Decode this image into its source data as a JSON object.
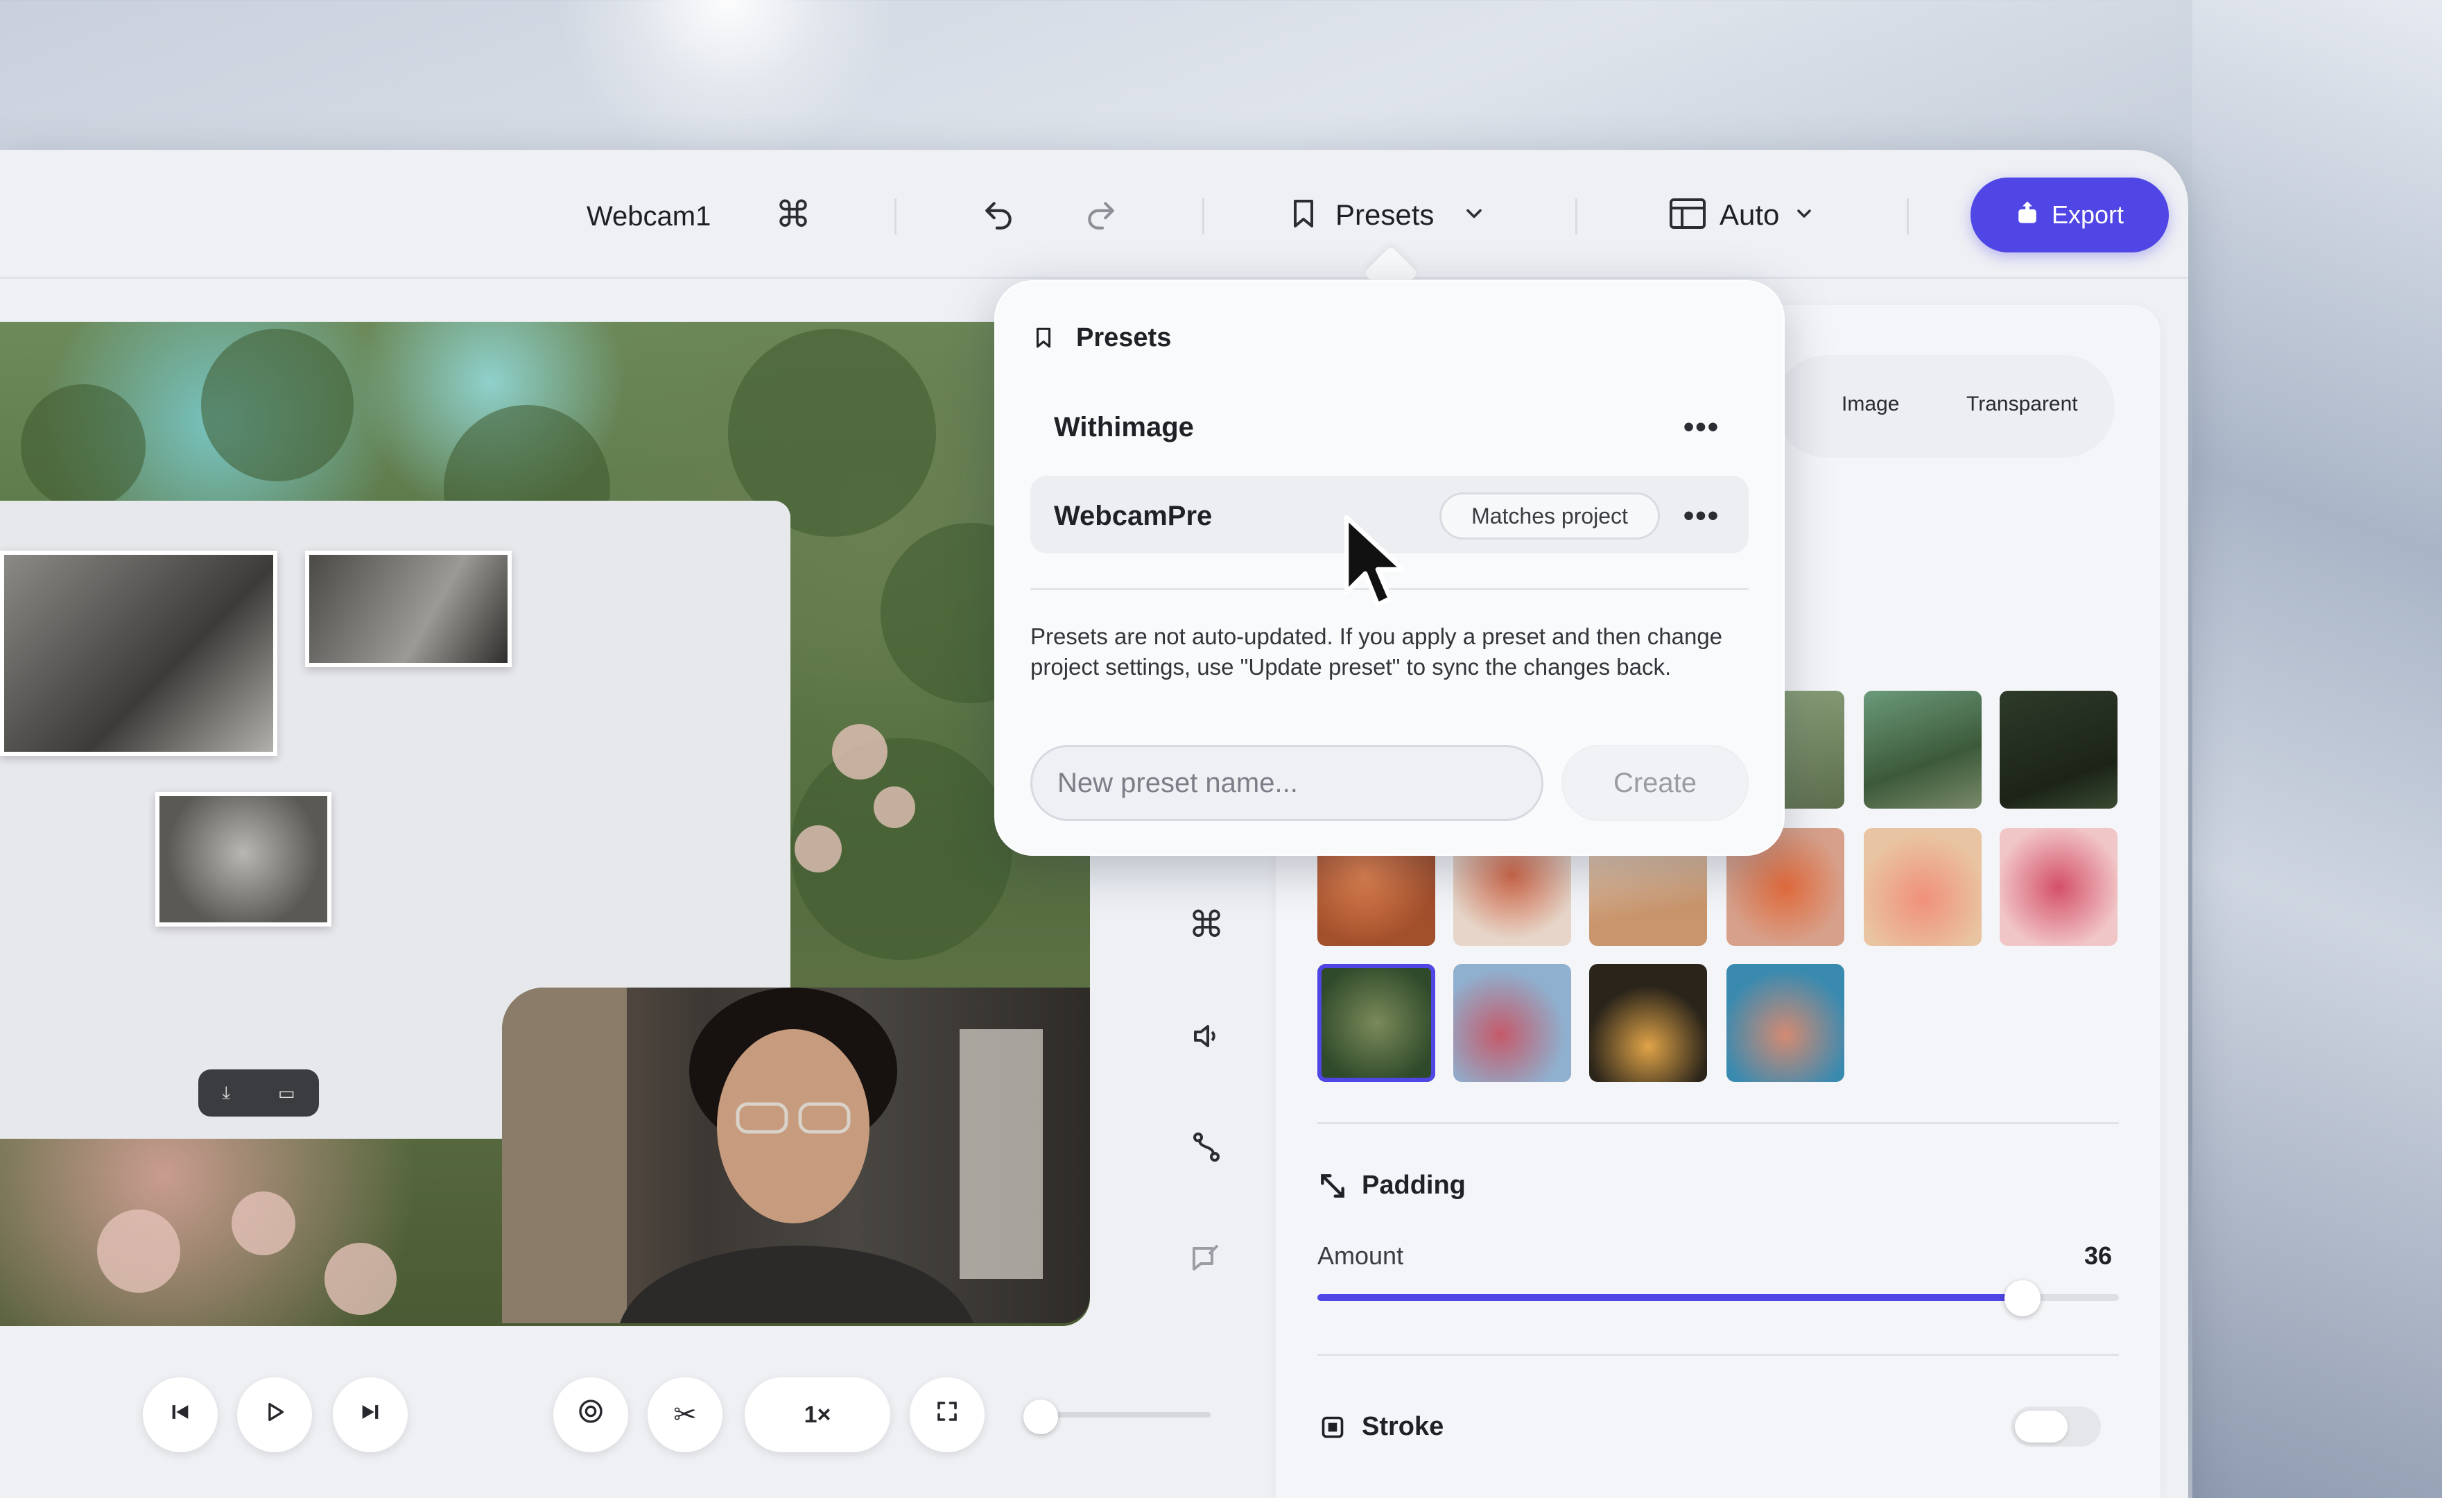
{
  "toolbar": {
    "project_name": "Webcam1",
    "presets_label": "Presets",
    "layout_label": "Auto",
    "export_label": "Export"
  },
  "background_tabs": {
    "image_label": "Image",
    "transparent_label": "Transparent"
  },
  "presets_popover": {
    "title": "Presets",
    "items": [
      {
        "name": "Withimage",
        "badge": ""
      },
      {
        "name": "WebcamPre",
        "badge": "Matches project"
      }
    ],
    "note": "Presets are not auto-updated. If you apply a preset and then change project settings, use \"Update preset\" to sync the changes back.",
    "input_placeholder": "New preset name...",
    "create_label": "Create"
  },
  "padding": {
    "title": "Padding",
    "amount_label": "Amount",
    "amount_value": "36",
    "slider_fraction": 0.88
  },
  "stroke": {
    "title": "Stroke",
    "enabled": false
  },
  "playback": {
    "speed_label": "1×"
  },
  "colors": {
    "accent": "#4f46e5"
  },
  "icons": {
    "command": "command-icon",
    "undo": "undo-icon",
    "redo": "redo-icon",
    "bookmark": "bookmark-icon",
    "layout": "layout-icon",
    "export": "export-icon"
  }
}
